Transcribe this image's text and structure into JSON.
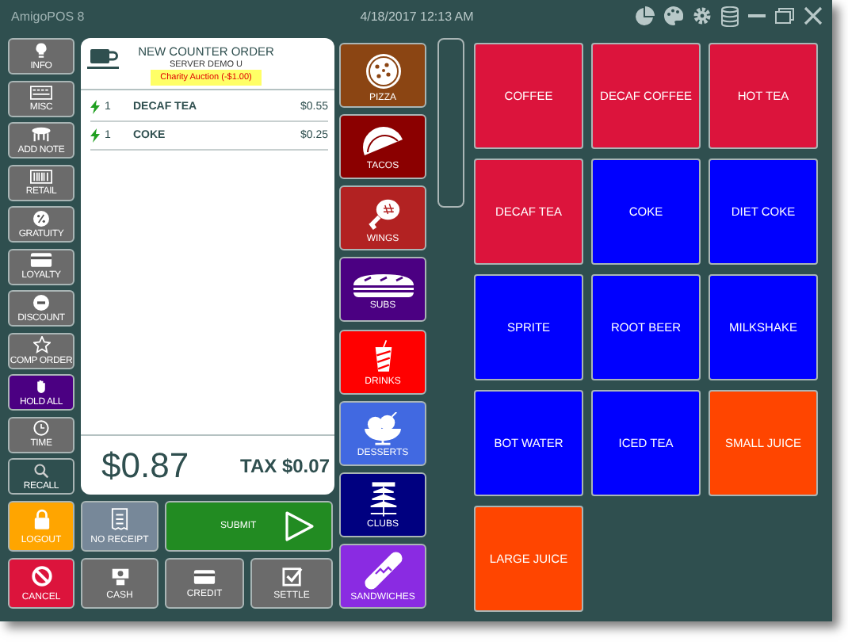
{
  "window": {
    "title": "AmigoPOS 8",
    "datetime": "4/18/2017 12:13 AM"
  },
  "left_buttons": [
    {
      "label": "INFO",
      "color": "#6b6b6b"
    },
    {
      "label": "MISC",
      "color": "#6b6b6b"
    },
    {
      "label": "ADD NOTE",
      "color": "#6b6b6b"
    },
    {
      "label": "RETAIL",
      "color": "#6b6b6b"
    },
    {
      "label": "GRATUITY",
      "color": "#6b6b6b"
    },
    {
      "label": "LOYALTY",
      "color": "#6b6b6b"
    },
    {
      "label": "DISCOUNT",
      "color": "#6b6b6b"
    },
    {
      "label": "COMP ORDER",
      "color": "#6b6b6b"
    },
    {
      "label": "HOLD ALL",
      "color": "#4b0082"
    },
    {
      "label": "TIME",
      "color": "#6b6b6b"
    },
    {
      "label": "RECALL",
      "color": "#2f4f4f"
    },
    {
      "label": "LOGOUT",
      "color": "#ffa500"
    },
    {
      "label": "CANCEL",
      "color": "#dc143c"
    }
  ],
  "order": {
    "title": "NEW COUNTER ORDER",
    "server": "SERVER DEMO U",
    "discount": "Charity Auction (-$1.00)",
    "lines": [
      {
        "qty": "1",
        "name": "DECAF TEA",
        "price": "$0.55"
      },
      {
        "qty": "1",
        "name": "COKE",
        "price": "$0.25"
      }
    ],
    "total": "$0.87",
    "tax": "TAX $0.07"
  },
  "action_buttons": [
    {
      "label": "NO RECEIPT",
      "color": "#778899"
    },
    {
      "label": "SUBMIT",
      "color": "#228b22"
    },
    {
      "label": "CASH",
      "color": "#6b6b6b"
    },
    {
      "label": "CREDIT",
      "color": "#6b6b6b"
    },
    {
      "label": "SETTLE",
      "color": "#6b6b6b"
    }
  ],
  "categories": [
    {
      "label": "PIZZA",
      "color": "#8b4513"
    },
    {
      "label": "TACOS",
      "color": "#8b0000"
    },
    {
      "label": "WINGS",
      "color": "#b22222"
    },
    {
      "label": "SUBS",
      "color": "#4b0082"
    },
    {
      "label": "DRINKS",
      "color": "#ff0000"
    },
    {
      "label": "DESSERTS",
      "color": "#4169e1"
    },
    {
      "label": "CLUBS",
      "color": "#000080"
    },
    {
      "label": "SANDWICHES",
      "color": "#8a2be2"
    }
  ],
  "items": [
    {
      "label": "COFFEE",
      "color": "#dc143c"
    },
    {
      "label": "DECAF COFFEE",
      "color": "#dc143c"
    },
    {
      "label": "HOT TEA",
      "color": "#dc143c"
    },
    {
      "label": "DECAF TEA",
      "color": "#dc143c"
    },
    {
      "label": "COKE",
      "color": "#0000ff"
    },
    {
      "label": "DIET COKE",
      "color": "#0000ff"
    },
    {
      "label": "SPRITE",
      "color": "#0000ff"
    },
    {
      "label": "ROOT BEER",
      "color": "#0000ff"
    },
    {
      "label": "MILKSHAKE",
      "color": "#0000ff"
    },
    {
      "label": "BOT WATER",
      "color": "#0000ff"
    },
    {
      "label": "ICED TEA",
      "color": "#0000ff"
    },
    {
      "label": "SMALL JUICE",
      "color": "#ff4500"
    },
    {
      "label": "LARGE JUICE",
      "color": "#ff4500"
    }
  ]
}
